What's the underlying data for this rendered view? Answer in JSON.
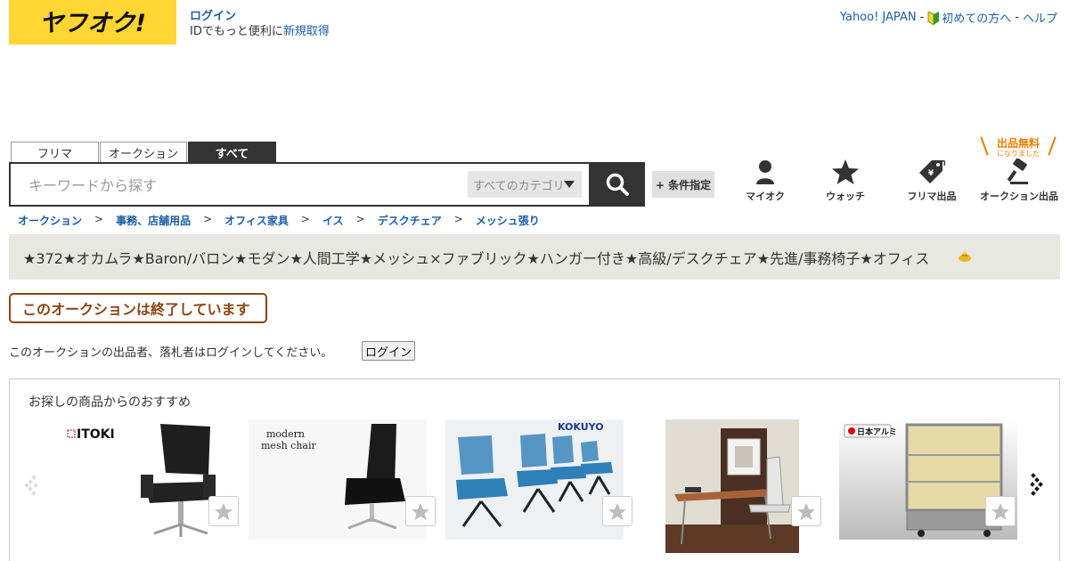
{
  "header": {
    "logo_text": "ヤフオク!",
    "login_link": "ログイン",
    "login_sub_prefix": "IDでもっと便利に",
    "login_sub_link": "新規取得",
    "links": [
      "Yahoo! JAPAN",
      "初めての方へ",
      "ヘルプ"
    ],
    "link_separator": "-"
  },
  "search": {
    "tabs": [
      "フリマ",
      "オークション",
      "すべて"
    ],
    "active_tab": "すべて",
    "placeholder": "キーワードから探す",
    "category": "すべてのカテゴリ",
    "condition_button": "+ 条件指定"
  },
  "nav": {
    "my_auction": "マイオク",
    "watch": "ウォッチ",
    "furima_sell": "フリマ出品",
    "auction_sell": "オークション出品",
    "free_listing": "出品無料",
    "free_listing_sub": "になりました"
  },
  "breadcrumb": [
    "オークション",
    "事務、店舗用品",
    "オフィス家具",
    "イス",
    "デスクチェア",
    "メッシュ張り"
  ],
  "breadcrumb_separator": ">",
  "item": {
    "title": "★372★オカムラ★Baron/バロン★モダン★人間工学★メッシュ×ファブリック★ハンガー付き★高級/デスクチェア★先進/事務椅子★オフィス",
    "ended_message": "このオークションは終了しています",
    "login_notice": "このオークションの出品者、落札者はログインしてください。",
    "login_button": "ログイン"
  },
  "recommendations": {
    "title": "お探しの商品からのおすすめ",
    "product_logos": [
      "ITOKI",
      "modern mesh chair",
      "KOKUYO",
      "",
      "日本アルミ"
    ]
  },
  "colors": {
    "brand_yellow": "#ffd633",
    "link_blue": "#1a5ea8",
    "dark": "#333333",
    "ended_brown": "#8b4513",
    "free_orange": "#ef7d00"
  }
}
